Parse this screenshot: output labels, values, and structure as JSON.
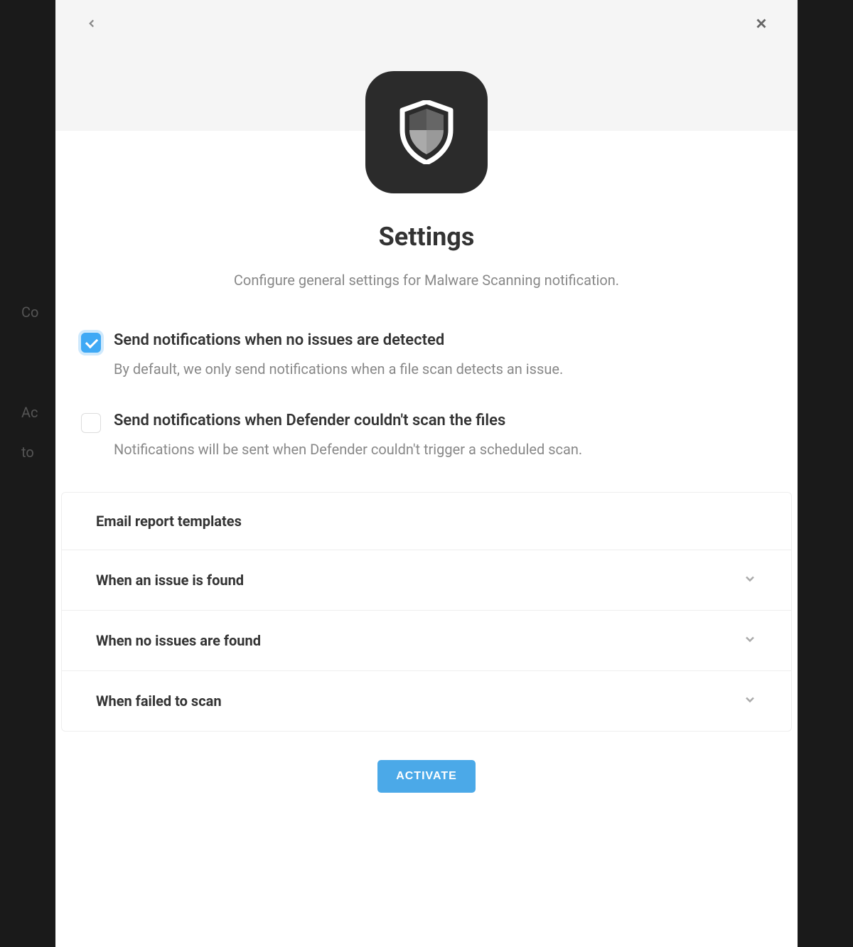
{
  "modal": {
    "title": "Settings",
    "subtitle": "Configure general settings for Malware Scanning notification.",
    "options": [
      {
        "label": "Send notifications when no issues are detected",
        "description": "By default, we only send notifications when a file scan detects an issue.",
        "checked": true
      },
      {
        "label": "Send notifications when Defender couldn't scan the files",
        "description": "Notifications will be sent when Defender couldn't trigger a scheduled scan.",
        "checked": false
      }
    ],
    "templates_header": "Email report templates",
    "templates": [
      {
        "label": "When an issue is found"
      },
      {
        "label": "When no issues are found"
      },
      {
        "label": "When failed to scan"
      }
    ],
    "activate_label": "ACTIVATE"
  }
}
